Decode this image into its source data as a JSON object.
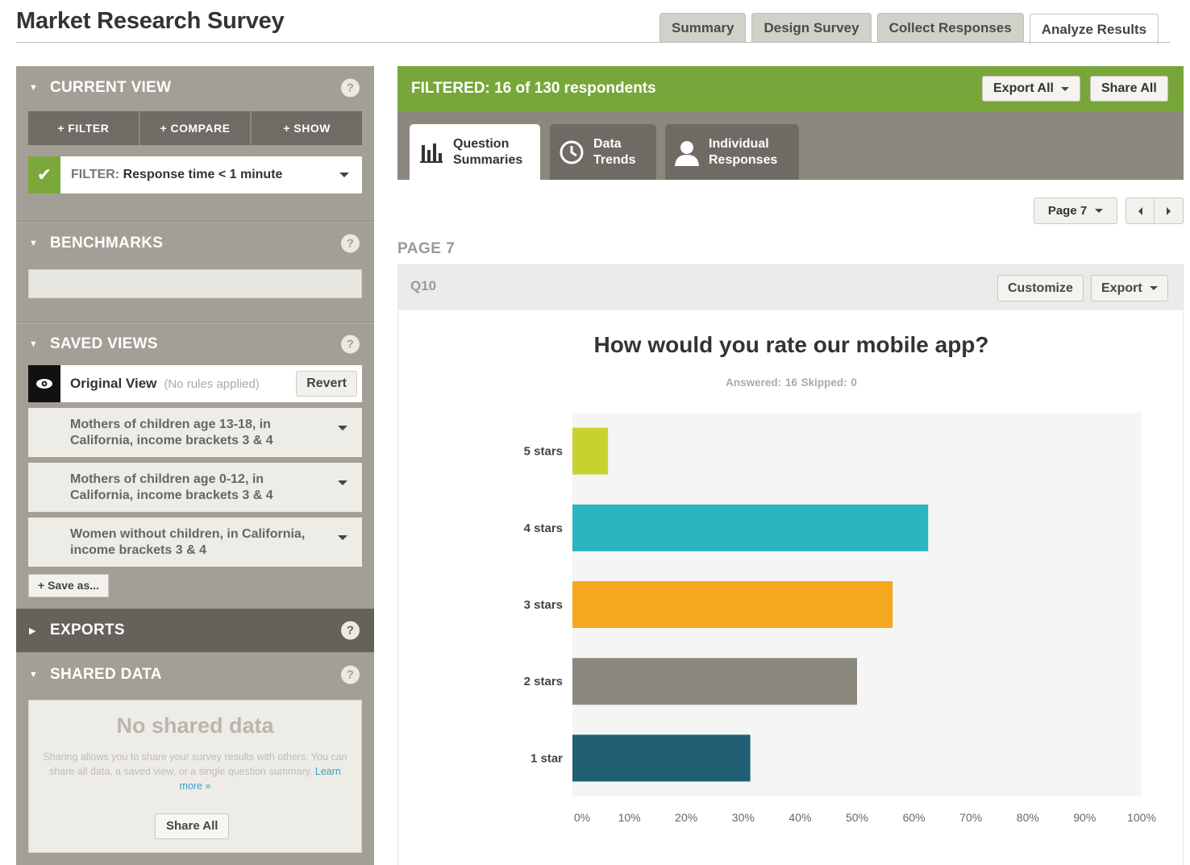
{
  "app": {
    "title": "Market Research Survey"
  },
  "tabs": [
    {
      "label": "Summary",
      "active": false
    },
    {
      "label": "Design Survey",
      "active": false
    },
    {
      "label": "Collect Responses",
      "active": false
    },
    {
      "label": "Analyze Results",
      "active": true
    }
  ],
  "sidebar": {
    "current_view": {
      "heading": "CURRENT VIEW",
      "help": "?",
      "buttons": [
        "+ FILTER",
        "+ COMPARE",
        "+ SHOW"
      ],
      "filter": {
        "label": "FILTER:",
        "value": "Response time < 1 minute"
      }
    },
    "benchmarks": {
      "heading": "BENCHMARKS",
      "help": "?"
    },
    "saved_views": {
      "heading": "SAVED VIEWS",
      "help": "?",
      "original": {
        "label": "Original View",
        "note": "(No rules applied)",
        "revert_label": "Revert"
      },
      "items": [
        {
          "label": "Mothers of children age 13-18, in California, income brackets 3 & 4"
        },
        {
          "label": "Mothers of children age 0-12, in California, income brackets 3 & 4"
        },
        {
          "label": "Women without children, in California, income brackets 3 & 4"
        }
      ],
      "save_as_label": "+ Save as..."
    },
    "exports": {
      "heading": "EXPORTS",
      "help": "?"
    },
    "shared_data": {
      "heading": "SHARED DATA",
      "help": "?",
      "empty_title": "No shared data",
      "empty_desc": "Sharing allows you to share your survey results with others. You can share all data, a saved view, or a single question summary.",
      "learn_more": "Learn more »",
      "share_all_label": "Share All"
    }
  },
  "main": {
    "filtered_status": "FILTERED: 16 of 130 respondents",
    "export_all_label": "Export All",
    "share_all_label": "Share All",
    "view_tabs": [
      {
        "label_1": "Question",
        "label_2": "Summaries",
        "icon": "bar-chart-icon",
        "active": true
      },
      {
        "label_1": "Data",
        "label_2": "Trends",
        "icon": "clock-icon",
        "active": false
      },
      {
        "label_1": "Individual",
        "label_2": "Responses",
        "icon": "user-icon",
        "active": false
      }
    ],
    "pager": {
      "label": "Page 7"
    },
    "page_label": "PAGE 7",
    "question": {
      "number": "Q10",
      "customize_label": "Customize",
      "export_label": "Export",
      "title": "How would you rate our mobile app?",
      "stats": "Answered: 16   Skipped: 0"
    }
  },
  "chart_data": {
    "type": "bar",
    "orientation": "horizontal",
    "categories": [
      "5 stars",
      "4 stars",
      "3 stars",
      "2 stars",
      "1 star"
    ],
    "values": [
      6.25,
      62.5,
      56.25,
      50,
      31.25
    ],
    "colors": [
      "#c8d22f",
      "#2bb5bf",
      "#f5a71d",
      "#8b887e",
      "#205e73"
    ],
    "x_ticks": [
      "0%",
      "10%",
      "20%",
      "30%",
      "40%",
      "50%",
      "60%",
      "70%",
      "80%",
      "90%",
      "100%"
    ],
    "xlim": [
      0,
      100
    ]
  }
}
